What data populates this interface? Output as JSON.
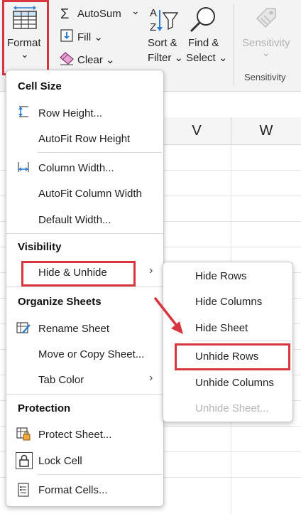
{
  "ribbon": {
    "format_label": "Format",
    "format_chevron": "⌄",
    "autosum_label": "AutoSum",
    "autosum_chevron": "⌄",
    "fill_label": "Fill ⌄",
    "clear_label": "Clear ⌄",
    "sortfilter_line1": "Sort &",
    "sortfilter_line2": "Filter ⌄",
    "findselect_line1": "Find &",
    "findselect_line2": "Select ⌄",
    "sensitivity_label": "Sensitivity",
    "sensitivity_chevron": "⌄",
    "sensitivity_group": "Sensitivity"
  },
  "sheet": {
    "columns": [
      "V",
      "W"
    ]
  },
  "format_menu": {
    "cell_size_title": "Cell Size",
    "row_height": "Row Height...",
    "autofit_row_height": "AutoFit Row Height",
    "column_width": "Column Width...",
    "autofit_column_width": "AutoFit Column Width",
    "default_width": "Default Width...",
    "visibility_title": "Visibility",
    "hide_unhide": "Hide & Unhide",
    "organize_title": "Organize Sheets",
    "rename_sheet": "Rename Sheet",
    "move_copy_sheet": "Move or Copy Sheet...",
    "tab_color": "Tab Color",
    "protection_title": "Protection",
    "protect_sheet": "Protect Sheet...",
    "lock_cell": "Lock Cell",
    "format_cells": "Format Cells..."
  },
  "hide_unhide_submenu": {
    "hide_rows": "Hide Rows",
    "hide_columns": "Hide Columns",
    "hide_sheet": "Hide Sheet",
    "unhide_rows": "Unhide Rows",
    "unhide_columns": "Unhide Columns",
    "unhide_sheet": "Unhide Sheet..."
  },
  "colors": {
    "highlight": "#d9353f",
    "accent": "#2b7cd3"
  }
}
